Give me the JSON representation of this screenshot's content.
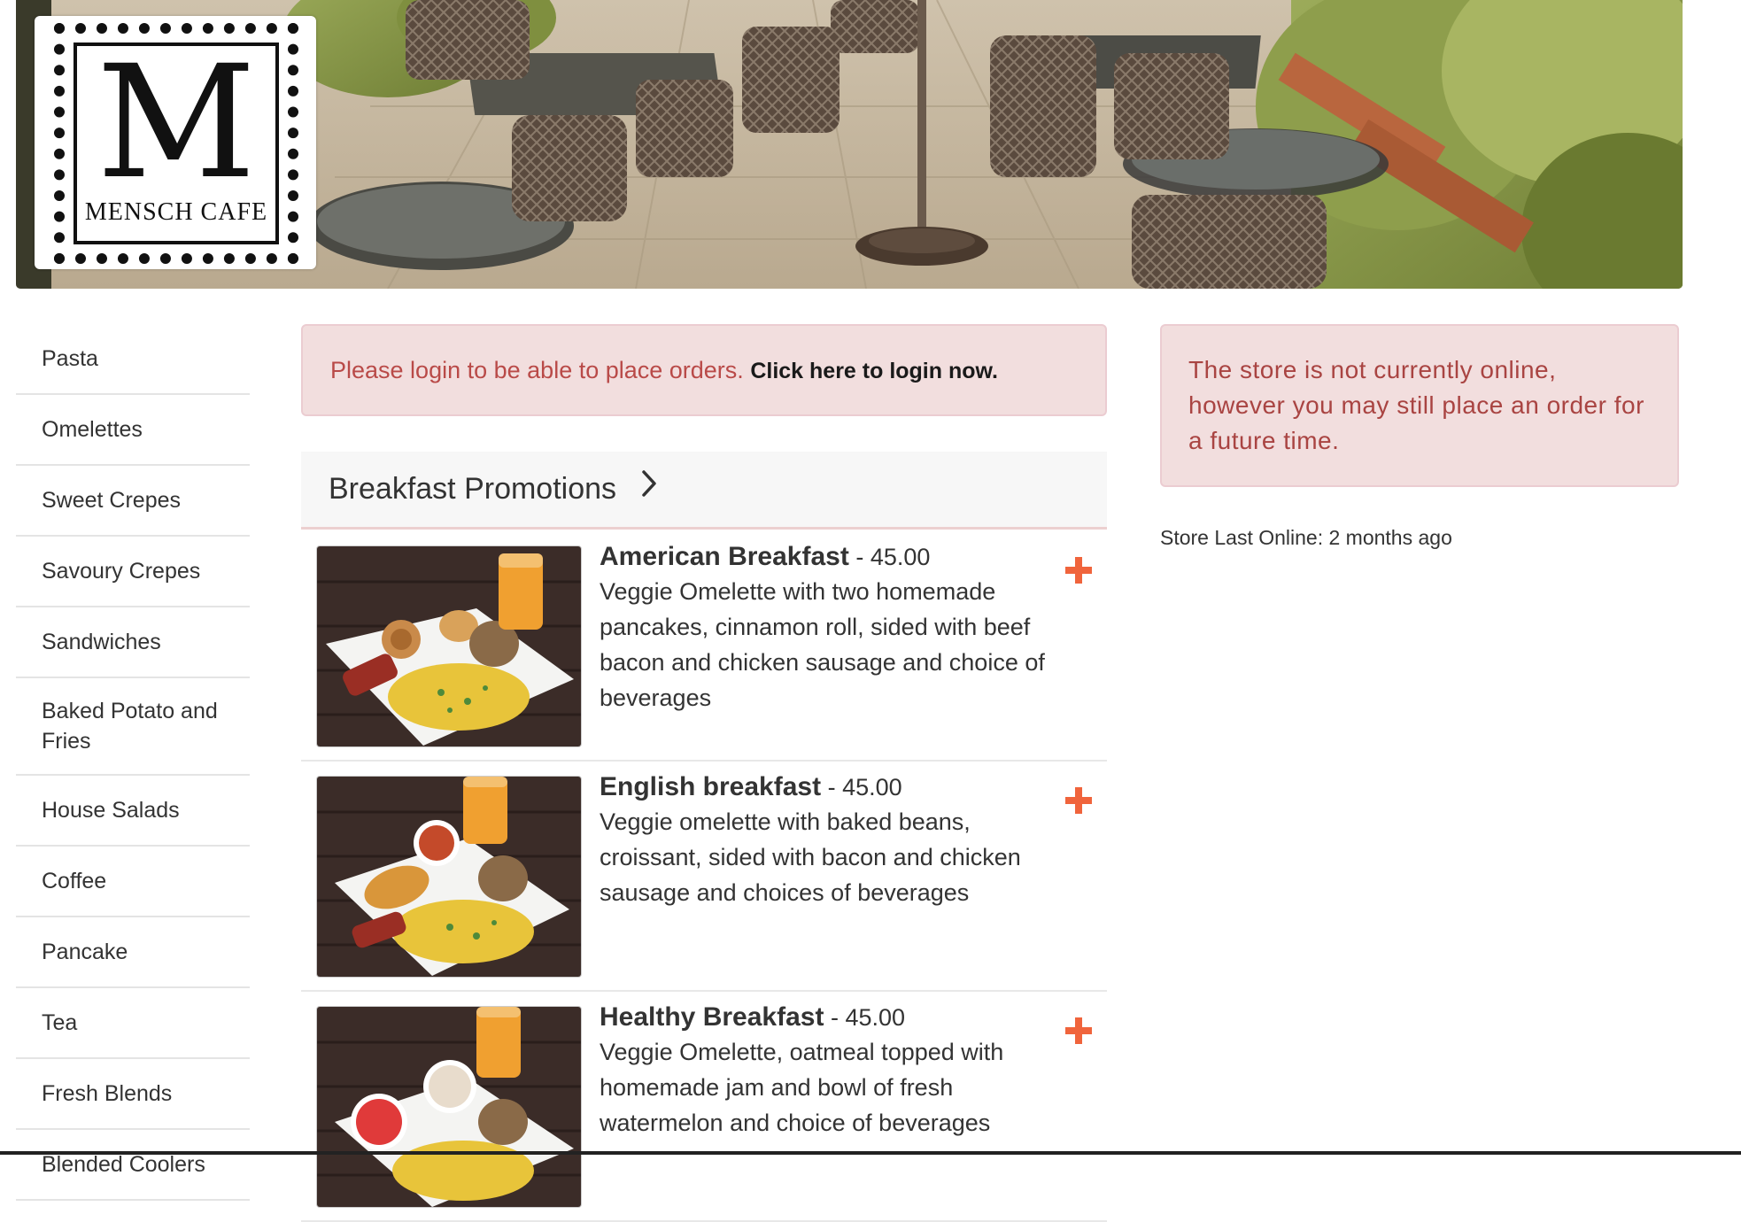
{
  "brand": {
    "logo_letter": "M",
    "logo_name": "MENSCH CAFE"
  },
  "sidebar": {
    "items": [
      {
        "label": "Pasta"
      },
      {
        "label": "Omelettes"
      },
      {
        "label": "Sweet Crepes"
      },
      {
        "label": "Savoury Crepes"
      },
      {
        "label": "Sandwiches"
      },
      {
        "label": "Baked Potato and Fries"
      },
      {
        "label": "House Salads"
      },
      {
        "label": "Coffee"
      },
      {
        "label": "Pancake"
      },
      {
        "label": "Tea"
      },
      {
        "label": "Fresh Blends"
      },
      {
        "label": "Blended Coolers"
      }
    ]
  },
  "login_alert": {
    "message": "Please login to be able to place orders.",
    "link": "Click here to login now."
  },
  "category": {
    "title": "Breakfast Promotions",
    "icon": "chevron-right-icon"
  },
  "items": [
    {
      "name": "American Breakfast",
      "separator": " - ",
      "price": "45.00",
      "description": "Veggie Omelette with two homemade pancakes, cinnamon roll, sided with beef bacon and chicken sausage and choice of beverages"
    },
    {
      "name": "English breakfast",
      "separator": " - ",
      "price": "45.00",
      "description": "Veggie omelette with baked beans, croissant, sided with bacon and chicken sausage and choices of beverages"
    },
    {
      "name": "Healthy Breakfast",
      "separator": " - ",
      "price": "45.00",
      "description": "Veggie Omelette, oatmeal topped with homemade jam and bowl of fresh watermelon and choice of beverages"
    }
  ],
  "store_status": {
    "message": "The store is not currently online, however you may still place an order for a future time.",
    "last_online": "Store Last Online: 2 months ago"
  },
  "colors": {
    "accent": "#f0643c",
    "alert_bg": "#f2dede",
    "alert_text": "#b94a48"
  }
}
